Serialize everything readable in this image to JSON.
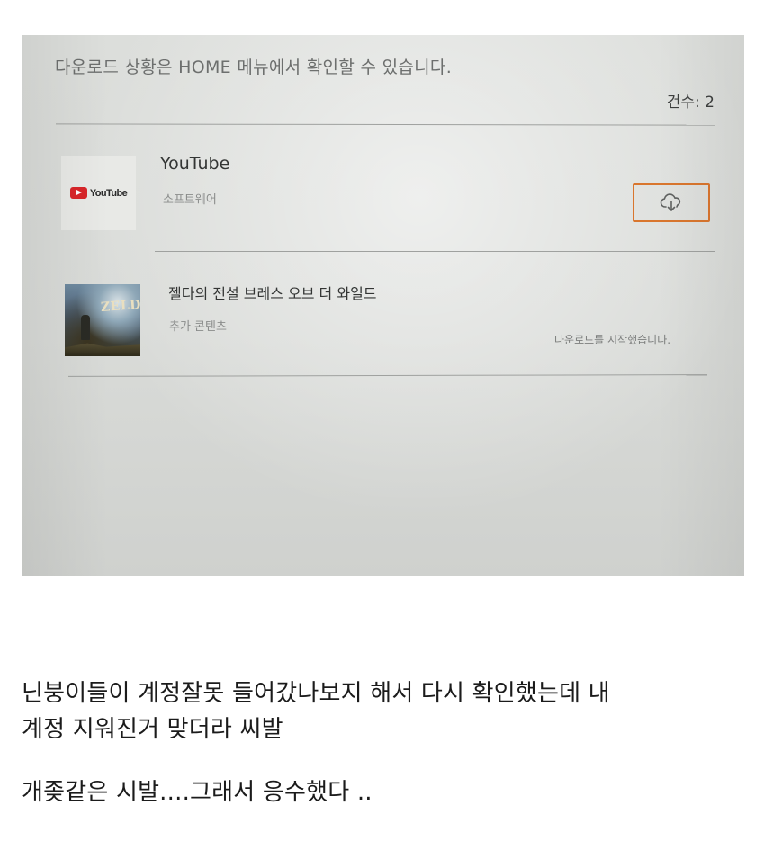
{
  "screen": {
    "notice": "다운로드 상황은 HOME 메뉴에서 확인할 수 있습니다.",
    "count_label": "건수: 2",
    "items": [
      {
        "title": "YouTube",
        "thumb_word": "YouTube",
        "subtitle": "소프트웨어",
        "action_icon": "cloud-download-icon"
      },
      {
        "title": "젤다의 전설 브레스 오브 더 와일드",
        "thumb_word": "ZELDA",
        "subtitle": "추가 콘텐츠",
        "status": "다운로드를 시작했습니다."
      }
    ],
    "colors": {
      "accent_orange": "#d9762e",
      "youtube_red": "#d8262a"
    }
  },
  "caption": {
    "line1": "닌붕이들이 계정잘못 들어갔나보지 해서 다시 확인했는데 내",
    "line2": "계정 지워진거 맞더라 씨발",
    "line3": "개좆같은 시발....그래서 응수했다 .."
  }
}
